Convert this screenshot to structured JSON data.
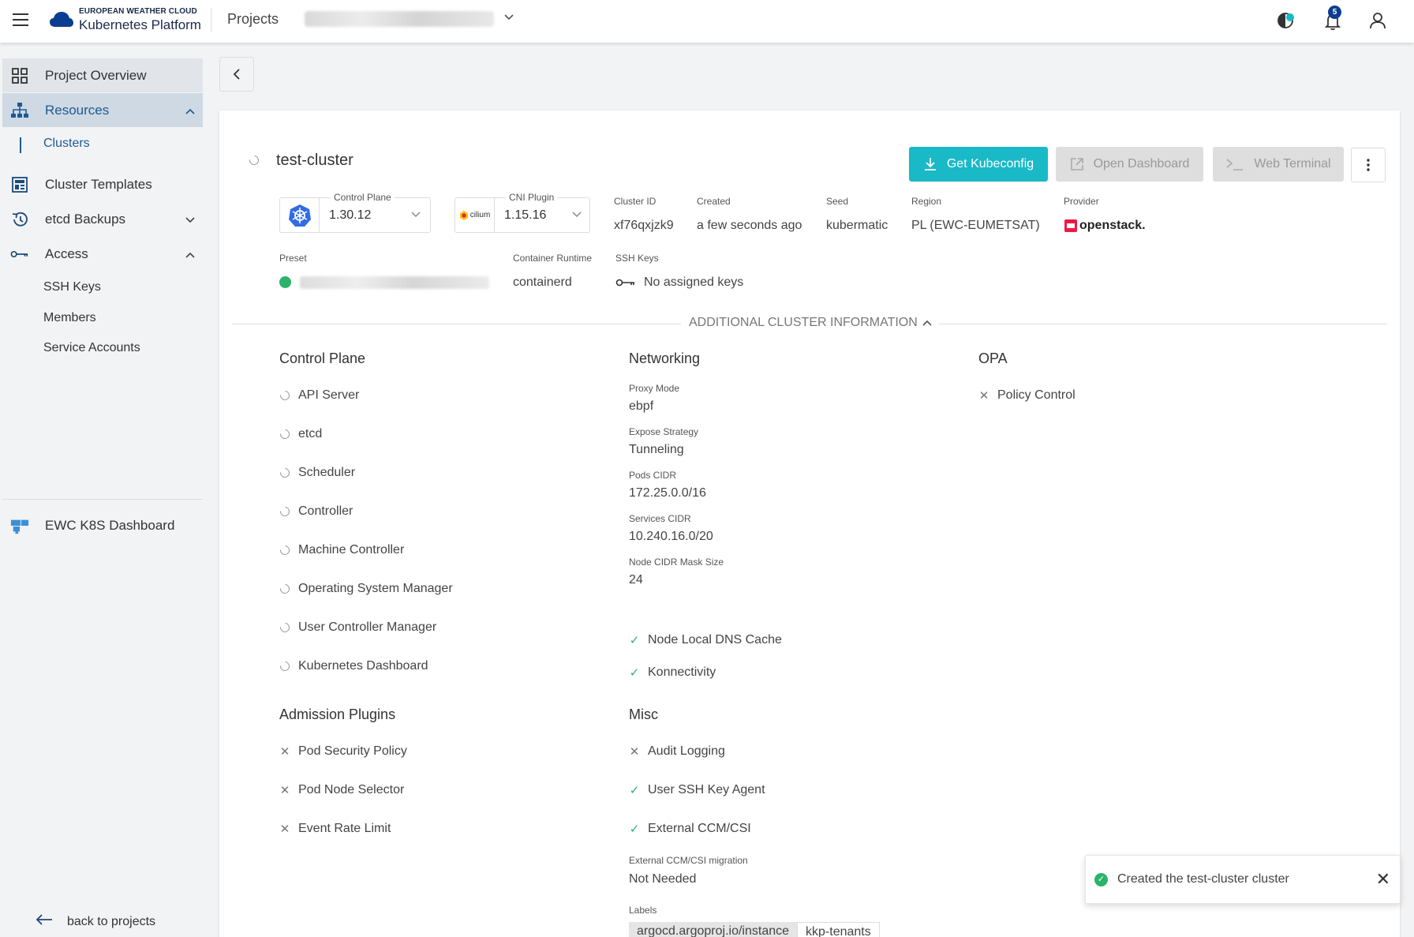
{
  "header": {
    "logo_top": "EUROPEAN WEATHER CLOUD",
    "logo_bottom": "Kubernetes Platform",
    "projects_label": "Projects",
    "notifications_count": "5"
  },
  "sidebar": {
    "items": [
      {
        "label": "Project Overview"
      },
      {
        "label": "Resources"
      },
      {
        "label": "Clusters"
      },
      {
        "label": "Cluster Templates"
      },
      {
        "label": "etcd Backups"
      },
      {
        "label": "Access"
      },
      {
        "label": "SSH Keys"
      },
      {
        "label": "Members"
      },
      {
        "label": "Service Accounts"
      },
      {
        "label": "EWC K8S Dashboard"
      }
    ],
    "back_to_projects": "back to projects"
  },
  "cluster": {
    "name": "test-cluster",
    "buttons": {
      "get_kubeconfig": "Get Kubeconfig",
      "open_dashboard": "Open Dashboard",
      "web_terminal": "Web Terminal"
    },
    "control_plane": {
      "legend": "Control Plane",
      "value": "1.30.12"
    },
    "cni_plugin": {
      "legend": "CNI Plugin",
      "value": "1.15.16",
      "logo_text": "cilium"
    },
    "cluster_id": {
      "label": "Cluster ID",
      "value": "xf76qxjzk9"
    },
    "created": {
      "label": "Created",
      "value": "a few seconds ago"
    },
    "seed": {
      "label": "Seed",
      "value": "kubermatic"
    },
    "region": {
      "label": "Region",
      "value": "PL (EWC-EUMETSAT)"
    },
    "provider": {
      "label": "Provider",
      "value": "openstack."
    },
    "preset": {
      "label": "Preset"
    },
    "container_runtime": {
      "label": "Container Runtime",
      "value": "containerd"
    },
    "ssh_keys": {
      "label": "SSH Keys",
      "value": "No assigned keys"
    },
    "additional_info_label": "ADDITIONAL CLUSTER INFORMATION"
  },
  "control_plane_section": {
    "title": "Control Plane",
    "items": [
      "API Server",
      "etcd",
      "Scheduler",
      "Controller",
      "Machine Controller",
      "Operating System Manager",
      "User Controller Manager",
      "Kubernetes Dashboard"
    ]
  },
  "networking": {
    "title": "Networking",
    "proxy_mode": {
      "label": "Proxy Mode",
      "value": "ebpf"
    },
    "expose_strategy": {
      "label": "Expose Strategy",
      "value": "Tunneling"
    },
    "pods_cidr": {
      "label": "Pods CIDR",
      "value": "172.25.0.0/16"
    },
    "services_cidr": {
      "label": "Services CIDR",
      "value": "10.240.16.0/20"
    },
    "node_cidr_mask": {
      "label": "Node CIDR Mask Size",
      "value": "24"
    },
    "node_local_dns": "Node Local DNS Cache",
    "konnectivity": "Konnectivity"
  },
  "opa": {
    "title": "OPA",
    "policy_control": "Policy Control"
  },
  "admission_plugins": {
    "title": "Admission Plugins",
    "items": [
      "Pod Security Policy",
      "Pod Node Selector",
      "Event Rate Limit"
    ]
  },
  "misc": {
    "title": "Misc",
    "audit_logging": "Audit Logging",
    "user_ssh_key_agent": "User SSH Key Agent",
    "external_ccm": "External CCM/CSI",
    "ccm_migration": {
      "label": "External CCM/CSI migration",
      "value": "Not Needed"
    },
    "labels_label": "Labels",
    "labels": [
      "argocd.argoproj.io/instance",
      "kkp-tenants"
    ]
  },
  "toast": {
    "message": "Created the test-cluster cluster"
  },
  "colors": {
    "primary": "#19b9c7",
    "success": "#2bb36a",
    "nav_active_text": "#1b5a94"
  }
}
